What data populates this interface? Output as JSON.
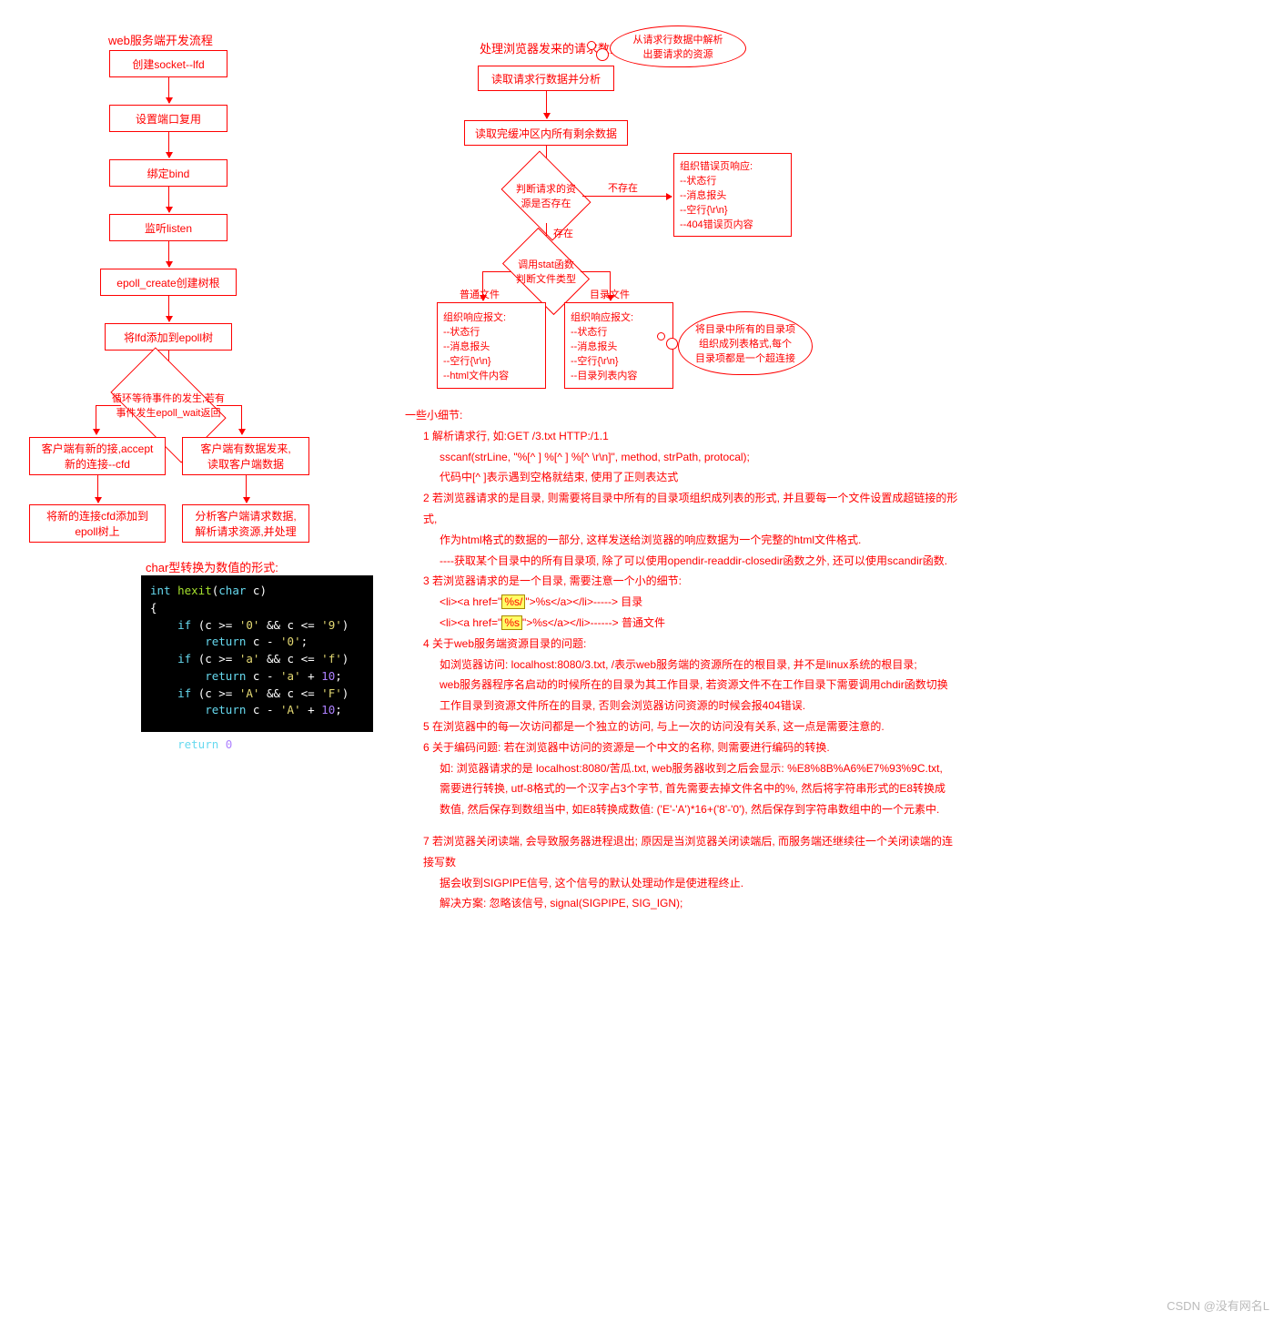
{
  "left": {
    "title": "web服务端开发流程",
    "steps": [
      "创建socket--lfd",
      "设置端口复用",
      "绑定bind",
      "监听listen",
      "epoll_create创建树根",
      "将lfd添加到epoll树"
    ],
    "loop": "循环等待事件的发生,若有\n事件发生epoll_wait返回",
    "leftBranch": [
      "客户端有新的接,accept\n新的连接--cfd",
      "将新的连接cfd添加到\nepoll树上"
    ],
    "rightBranch": [
      "客户端有数据发来,\n读取客户端数据",
      "分析客户端请求数据,\n解析请求资源,并处理"
    ],
    "codeTitle": "char型转换为数值的形式:",
    "code": "int hexit(char c)\n{\n    if (c >= '0' && c <= '9')\n        return c - '0';\n    if (c >= 'a' && c <= 'f')\n        return c - 'a' + 10;\n    if (c >= 'A' && c <= 'F')\n        return c - 'A' + 10;\n\n    return 0;\n}"
  },
  "right": {
    "title": "处理浏览器发来的请求数据",
    "cloudTop": "从请求行数据中解析\n出要请求的资源",
    "step1": "读取请求行数据并分析",
    "step2": "读取完缓冲区内所有剩余数据",
    "diamondRes": "判断请求的资\n源是否存在",
    "lblNot": "不存在",
    "lblExist": "存在",
    "errBox": "组织错误页响应:\n--状态行\n--消息报头\n--空行{\\r\\n}\n--404错误页内容",
    "diamondStat": "调用stat函数\n判断文件类型",
    "lblFile": "普通文件",
    "lblDir": "目录文件",
    "fileBox": "组织响应报文:\n--状态行\n--消息报头\n--空行{\\r\\n}\n--html文件内容",
    "dirBox": "组织响应报文:\n--状态行\n--消息报头\n--空行{\\r\\n}\n--目录列表内容",
    "cloudDir": "将目录中所有的目录项\n组织成列表格式,每个\n目录项都是一个超连接"
  },
  "notes": {
    "header": "一些小细节:",
    "n1a": "1 解析请求行, 如:GET /3.txt HTTP:/1.1",
    "n1b": "sscanf(strLine, \"%[^ ] %[^ ] %[^ \\r\\n]\", method, strPath, protocal);",
    "n1c": "代码中[^ ]表示遇到空格就结束, 使用了正则表达式",
    "n2a": "2 若浏览器请求的是目录, 则需要将目录中所有的目录项组织成列表的形式, 并且要每一个文件设置成超链接的形式,",
    "n2b": "作为html格式的数据的一部分, 这样发送给浏览器的响应数据为一个完整的html文件格式.",
    "n2c": "----获取某个目录中的所有目录项, 除了可以使用opendir-readdir-closedir函数之外, 还可以使用scandir函数.",
    "n3a": "3 若浏览器请求的是一个目录, 需要注意一个小的细节:",
    "n3b": "<li><a href=\"%s/\">%s</a></li>-----> 目录",
    "n3c": "<li><a href=\"%s\">%s</a></li>------> 普通文件",
    "n4a": "4 关于web服务端资源目录的问题:",
    "n4b": "如浏览器访问: localhost:8080/3.txt, /表示web服务端的资源所在的根目录, 并不是linux系统的根目录;",
    "n4c": "web服务器程序名启动的时候所在的目录为其工作目录, 若资源文件不在工作目录下需要调用chdir函数切换",
    "n4d": "工作目录到资源文件所在的目录, 否则会浏览器访问资源的时候会报404错误.",
    "n5": "5 在浏览器中的每一次访问都是一个独立的访问, 与上一次的访问没有关系, 这一点是需要注意的.",
    "n6a": "6 关于编码问题: 若在浏览器中访问的资源是一个中文的名称, 则需要进行编码的转换.",
    "n6b": "如: 浏览器请求的是 localhost:8080/苦瓜.txt, web服务器收到之后会显示: %E8%8B%A6%E7%93%9C.txt,",
    "n6c": "需要进行转换, utf-8格式的一个汉字占3个字节, 首先需要去掉文件名中的%, 然后将字符串形式的E8转换成",
    "n6d": "数值, 然后保存到数组当中, 如E8转换成数值: ('E'-'A')*16+('8'-'0'), 然后保存到字符串数组中的一个元素中.",
    "n7a": "7 若浏览器关闭读端, 会导致服务器进程退出; 原因是当浏览器关闭读端后, 而服务端还继续往一个关闭读端的连接写数",
    "n7b": "据会收到SIGPIPE信号, 这个信号的默认处理动作是使进程终止.",
    "n7c": "解决方案: 忽略该信号, signal(SIGPIPE, SIG_IGN);"
  },
  "watermark": "CSDN @没有网名L"
}
